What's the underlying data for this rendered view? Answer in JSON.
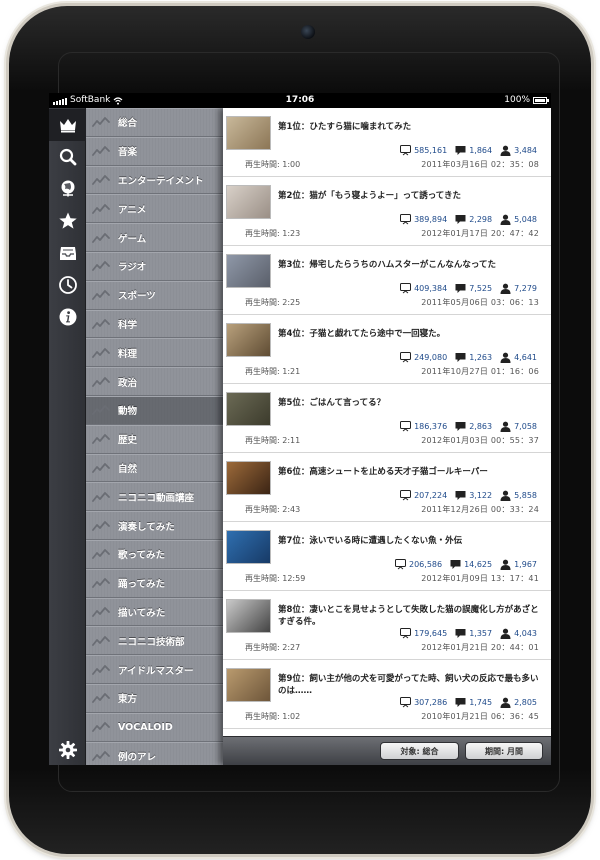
{
  "statusbar": {
    "carrier": "SoftBank",
    "time": "17:06",
    "battery": "100%"
  },
  "rail": {
    "items": [
      {
        "icon": "crown-icon",
        "active": true
      },
      {
        "icon": "search-icon"
      },
      {
        "icon": "globe-icon"
      },
      {
        "icon": "star-icon"
      },
      {
        "icon": "inbox-icon"
      },
      {
        "icon": "clock-icon"
      },
      {
        "icon": "info-icon"
      }
    ],
    "settings_icon": "gear-icon"
  },
  "categories": {
    "active_index": 10,
    "items": [
      "総合",
      "音楽",
      "エンターテイメント",
      "アニメ",
      "ゲーム",
      "ラジオ",
      "スポーツ",
      "科学",
      "料理",
      "政治",
      "動物",
      "歴史",
      "自然",
      "ニコニコ動画講座",
      "演奏してみた",
      "歌ってみた",
      "踊ってみた",
      "描いてみた",
      "ニコニコ技術部",
      "アイドルマスター",
      "東方",
      "VOCALOID",
      "例のアレ"
    ]
  },
  "duration_label": "再生時間:",
  "ranking": [
    {
      "title": "第1位：ひたすら猫に噛まれてみた",
      "duration": "1:00",
      "views": "585,161",
      "comments": "1,864",
      "mylists": "3,484",
      "date": "2011年03月16日 02：35：08",
      "thumb_colors": [
        "#c8b89a",
        "#8c7656"
      ]
    },
    {
      "title": "第2位：猫が「もう寝ようよー」って誘ってきた",
      "duration": "1:23",
      "views": "389,894",
      "comments": "2,298",
      "mylists": "5,048",
      "date": "2012年01月17日 20：47：42",
      "thumb_colors": [
        "#d8d0c8",
        "#9a8f86"
      ]
    },
    {
      "title": "第3位：帰宅したらうちのハムスターがこんなんなってた",
      "duration": "2:25",
      "views": "409,384",
      "comments": "7,525",
      "mylists": "7,279",
      "date": "2011年05月06日 03：06：13",
      "thumb_colors": [
        "#8f98a8",
        "#5a5f6a"
      ]
    },
    {
      "title": "第4位：子猫と戯れてたら途中で一回寝た。",
      "duration": "1:21",
      "views": "249,080",
      "comments": "1,263",
      "mylists": "4,641",
      "date": "2011年10月27日 01：16：06",
      "thumb_colors": [
        "#b8a07c",
        "#5f4c33"
      ]
    },
    {
      "title": "第5位：ごはんて言ってる？",
      "duration": "2:11",
      "views": "186,376",
      "comments": "2,863",
      "mylists": "7,058",
      "date": "2012年01月03日 00：55：37",
      "thumb_colors": [
        "#6b6a55",
        "#3c3b2c"
      ]
    },
    {
      "title": "第6位：高速シュートを止める天才子猫ゴールキーパー",
      "duration": "2:43",
      "views": "207,224",
      "comments": "3,122",
      "mylists": "5,858",
      "date": "2011年12月26日 00：33：24",
      "thumb_colors": [
        "#9c6a3a",
        "#3b2414"
      ]
    },
    {
      "title": "第7位：泳いでいる時に遭遇したくない魚・外伝",
      "duration": "12:59",
      "views": "206,586",
      "comments": "14,625",
      "mylists": "1,967",
      "date": "2012年01月09日 13：17：41",
      "thumb_colors": [
        "#2f6fb0",
        "#173a66"
      ]
    },
    {
      "title": "第8位：凄いとこを見せようとして失敗した猫の誤魔化し方があざとすぎる件。",
      "duration": "2:27",
      "views": "179,645",
      "comments": "1,357",
      "mylists": "4,043",
      "date": "2012年01月21日 20：44：01",
      "thumb_colors": [
        "#c9c9c9",
        "#444"
      ]
    },
    {
      "title": "第9位：飼い主が他の犬を可愛がってた時、飼い犬の反応で最も多いのは……",
      "duration": "1:02",
      "views": "307,286",
      "comments": "1,745",
      "mylists": "2,805",
      "date": "2010年01月21日 06：36：45",
      "thumb_colors": [
        "#b99a6e",
        "#6e563a"
      ]
    }
  ],
  "toolbar": {
    "target_label": "対象: 総合",
    "period_label": "期間: 月間"
  }
}
